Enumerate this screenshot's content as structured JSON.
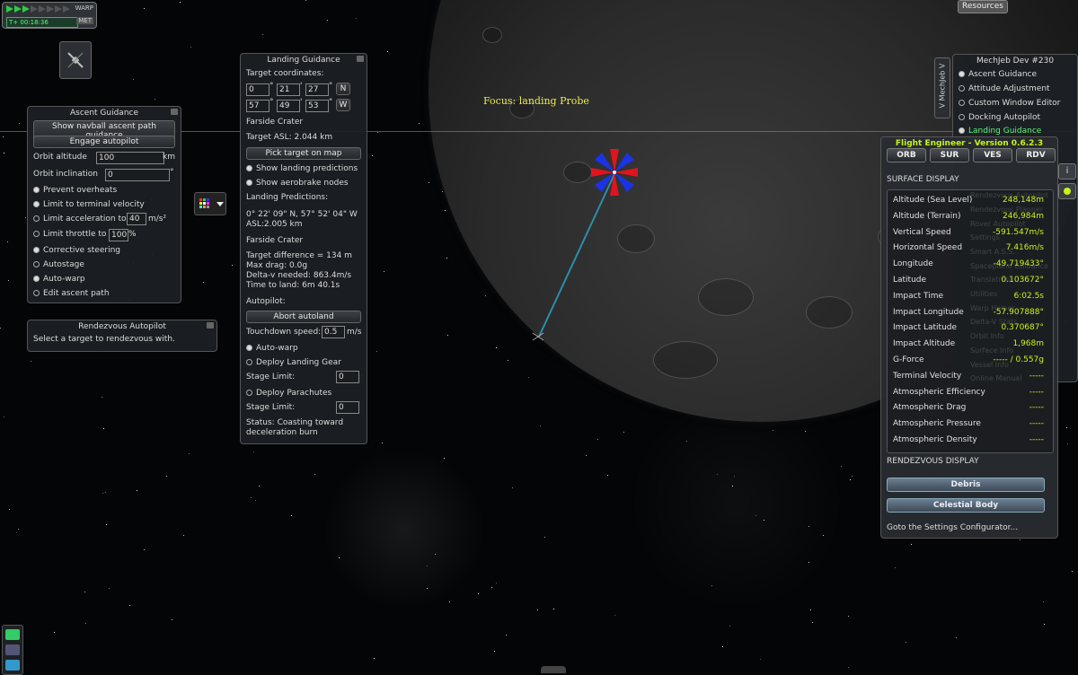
{
  "hud": {
    "warp_label": "WARP",
    "time": "T+ 00:18:36",
    "met_label": "MET",
    "focus": "Focus: landing Probe",
    "resources": "Resources"
  },
  "ascent": {
    "title": "Ascent Guidance",
    "btn_navball": "Show navball ascent path guidance",
    "btn_engage": "Engage autopilot",
    "orbit_alt_label": "Orbit altitude",
    "orbit_alt_value": "100",
    "orbit_alt_unit": "km",
    "orbit_inc_label": "Orbit inclination",
    "orbit_inc_value": "0",
    "orbit_inc_unit": "°",
    "opt_prevent": "Prevent overheats",
    "opt_terminal": "Limit to terminal velocity",
    "opt_accel": "Limit acceleration to",
    "accel_value": "40",
    "accel_unit": "m/s²",
    "opt_throttle": "Limit throttle to",
    "throttle_value": "100",
    "throttle_unit": "%",
    "opt_corrective": "Corrective steering",
    "opt_autostage": "Autostage",
    "opt_autowarp": "Auto-warp",
    "opt_edit": "Edit ascent path"
  },
  "rendezvous": {
    "title": "Rendezvous Autopilot",
    "text": "Select a target to rendezvous with."
  },
  "landing": {
    "title": "Landing Guidance",
    "target_coords_label": "Target coordinates:",
    "lat_d": "0",
    "lat_m": "21",
    "lat_s": "27",
    "lat_dir": "N",
    "lon_d": "57",
    "lon_m": "49",
    "lon_s": "53",
    "lon_dir": "W",
    "deg_sym": "°",
    "min_sym": "'",
    "sec_sym": "\"",
    "crater1": "Farside Crater",
    "target_asl": "Target ASL: 2.044 km",
    "pick_btn": "Pick target on map",
    "show_pred": "Show landing predictions",
    "show_aero": "Show aerobrake nodes",
    "pred_label": "Landing Predictions:",
    "pred_coords": "0° 22' 09\" N, 57° 52' 04\" W",
    "pred_asl": "ASL:2.005 km",
    "crater2": "Farside Crater",
    "target_diff": "Target difference = 134 m",
    "max_drag": "Max drag: 0.0g",
    "delta_v": "Delta-v needed: 863.4m/s",
    "time_land": "Time to land: 6m 40.1s",
    "autopilot_label": "Autopilot:",
    "abort_btn": "Abort autoland",
    "touchdown_label": "Touchdown speed:",
    "touchdown_value": "0.5",
    "touchdown_unit": "m/s",
    "autowarp": "Auto-warp",
    "deploy_gear": "Deploy Landing Gear",
    "stage_limit_label": "Stage Limit:",
    "stage_limit_1": "0",
    "deploy_chutes": "Deploy Parachutes",
    "stage_limit_2": "0",
    "status": "Status: Coasting toward deceleration burn"
  },
  "mechjeb": {
    "tab_label": "V MechJeb V",
    "title": "MechJeb Dev #230",
    "items": [
      "Ascent Guidance",
      "Attitude Adjustment",
      "Custom Window Editor",
      "Docking Autopilot",
      "Landing Guidance"
    ],
    "ghost_items": [
      "Maneuver Planner",
      "Node Editor",
      "RCS Balancer",
      "Rendezvous Autopilot",
      "Rendezvous Planner",
      "Rover Autopilot",
      "Settings",
      "Smart A.S.S.",
      "Spaceplane Guidance",
      "Translatron",
      "Utilities",
      "Warp Helper",
      "Delta-V Stats",
      "Orbit Info",
      "Surface Info",
      "Vessel Info",
      "Online Manual"
    ]
  },
  "fe": {
    "title": "Flight Engineer - Version 0.6.2.3",
    "tabs": [
      "ORB",
      "SUR",
      "VES",
      "RDV"
    ],
    "surface_header": "SURFACE DISPLAY",
    "rows": [
      {
        "k": "Altitude (Sea Level)",
        "v": "248,148m"
      },
      {
        "k": "Altitude (Terrain)",
        "v": "246,984m"
      },
      {
        "k": "Vertical Speed",
        "v": "-591.547m/s"
      },
      {
        "k": "Horizontal Speed",
        "v": "7.416m/s"
      },
      {
        "k": "Longitude",
        "v": "-49.719433°"
      },
      {
        "k": "Latitude",
        "v": "0.103672°"
      },
      {
        "k": "Impact Time",
        "v": "6:02.5s"
      },
      {
        "k": "Impact Longitude",
        "v": "-57.907888°"
      },
      {
        "k": "Impact Latitude",
        "v": "0.370687°"
      },
      {
        "k": "Impact Altitude",
        "v": "1,968m"
      },
      {
        "k": "G-Force",
        "v": "----- / 0.557g"
      },
      {
        "k": "Terminal Velocity",
        "v": "-----"
      },
      {
        "k": "Atmospheric Efficiency",
        "v": "-----"
      },
      {
        "k": "Atmospheric Drag",
        "v": "-----"
      },
      {
        "k": "Atmospheric Pressure",
        "v": "-----"
      },
      {
        "k": "Atmospheric Density",
        "v": "-----"
      }
    ],
    "rdv_header": "RENDEZVOUS DISPLAY",
    "btn_debris": "Debris",
    "btn_celestial": "Celestial Body",
    "settings_link": "Goto the Settings Configurator..."
  },
  "colors": {
    "accent_yellow": "#c6f31a",
    "focus_yellow": "#e7ee4a",
    "warp_green": "#2ecc40",
    "trajectory": "#2a8fa8"
  }
}
